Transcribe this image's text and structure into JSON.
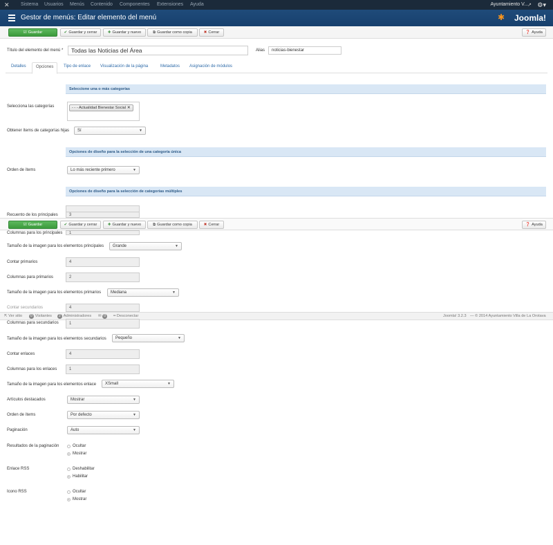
{
  "navbar": {
    "menu_items": [
      "Sistema",
      "Usuarios",
      "Menús",
      "Contenido",
      "Componentes",
      "Extensiones",
      "Ayuda"
    ],
    "user": "Ayuntamiento V..."
  },
  "header": {
    "title": "Gestor de menús: Editar elemento del menú",
    "brand": "Joomla!"
  },
  "toolbar": {
    "save": "Guardar",
    "save_close": "Guardar y cerrar",
    "save_new": "Guardar y nuevo",
    "save_copy": "Guardar como copia",
    "close": "Cerrar",
    "help": "Ayuda"
  },
  "form": {
    "title_label": "Título del elemento del menú *",
    "title_value": "Todas las Noticias del Área",
    "alias_label": "Alias",
    "alias_value": "noticias-bienestar"
  },
  "tabs": [
    "Detalles",
    "Opciones",
    "Tipo de enlace",
    "Visualización de la página",
    "Metadatos",
    "Asignación de módulos"
  ],
  "sections": {
    "categories": "Seleccione una o más categorías",
    "single_layout": "Opciones de diseño para la selección de una categoría única",
    "multi_layout": "Opciones de diseño para la selección de categorías múltiples"
  },
  "fields": {
    "select_categories_label": "Selecciona las categorías",
    "category_chip": "- - - Actualidad Bienestar Social",
    "child_items_label": "Obtener ítems de categorías hijas",
    "child_items_value": "Sí",
    "order_items_label": "Orden de ítems",
    "order_items_value": "Lo más reciente primero",
    "leading_count_label": "Recuento de los principales",
    "leading_count_value": "3",
    "leading_columns_label": "Columnas para los principales",
    "leading_columns_value": "1",
    "leading_image_label": "Tamaño de la imagen para los elementos principales",
    "leading_image_value": "Grande",
    "primary_count_label": "Contar primarios",
    "primary_count_value": "4",
    "primary_columns_label": "Columnas para primarios",
    "primary_columns_value": "2",
    "primary_image_label": "Tamaño de la imagen para los elementos primarios",
    "primary_image_value": "Mediana",
    "secondary_count_label": "Contar secundarios",
    "secondary_count_value": "4",
    "secondary_columns_label": "Columnas para secundarios",
    "secondary_columns_value": "1",
    "secondary_image_label": "Tamaño de la imagen para los elementos secundarios",
    "secondary_image_value": "Pequeño",
    "links_count_label": "Contar enlaces",
    "links_count_value": "4",
    "links_columns_label": "Columnas para los enlaces",
    "links_columns_value": "1",
    "links_image_label": "Tamaño de la imagen para los elementos enlace",
    "links_image_value": "XSmall",
    "featured_label": "Artículos destacados",
    "featured_value": "Mostrar",
    "order_label": "Orden de ítems",
    "order_value": "Por defecto",
    "pagination_label": "Paginación",
    "pagination_value": "Auto",
    "pagination_results_label": "Resultados de la paginación",
    "pagination_results_options": [
      "Ocultar",
      "Mostrar"
    ],
    "rss_link_label": "Enlace RSS",
    "rss_link_options": [
      "Deshabilitar",
      "Habilitar"
    ],
    "rss_icon_label": "Icono RSS",
    "rss_icon_options": [
      "Ocultar",
      "Mostrar"
    ]
  },
  "statusbar": {
    "view_site": "Ver sitio",
    "visitors_count": "0",
    "visitors": "Visitantes",
    "admins_count": "2",
    "admins": "Administradores",
    "messages_count": "0",
    "logout": "Desconectar",
    "version": "Joomla! 3.2.3",
    "copyright": "— © 2014 Ayuntamiento Villa de La Orotava"
  }
}
